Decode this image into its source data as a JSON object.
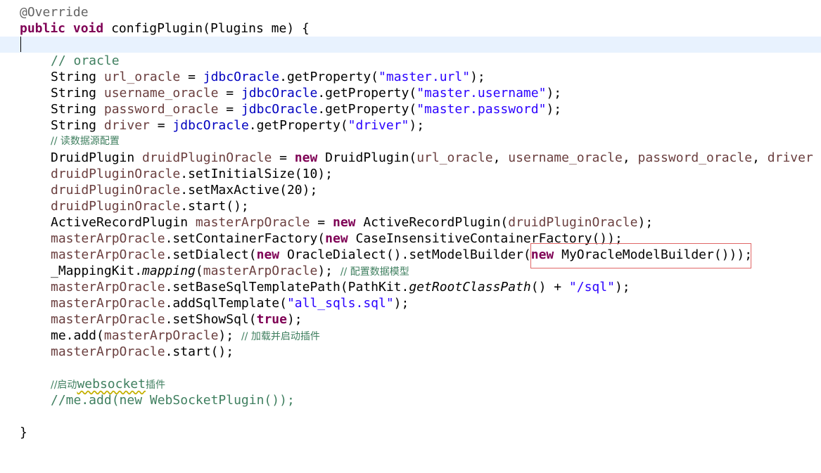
{
  "editor": {
    "annotation": "@Override",
    "signature": {
      "kw_public": "public",
      "kw_void": "void",
      "rest": " configPlugin(Plugins me) {"
    },
    "comment_oracle": "// oracle",
    "l_url": [
      "String ",
      "url_oracle",
      " = ",
      "jdbcOracle",
      ".getProperty(",
      "\"master.url\"",
      ");"
    ],
    "l_user": [
      "String ",
      "username_oracle",
      " = ",
      "jdbcOracle",
      ".getProperty(",
      "\"master.username\"",
      ");"
    ],
    "l_pass": [
      "String ",
      "password_oracle",
      " = ",
      "jdbcOracle",
      ".getProperty(",
      "\"master.password\"",
      ");"
    ],
    "l_driver": [
      "String ",
      "driver",
      " = ",
      "jdbcOracle",
      ".getProperty(",
      "\"driver\"",
      ");"
    ],
    "comment_read": "// 读数据源配置",
    "l_druid": [
      "DruidPlugin ",
      "druidPluginOracle",
      " = ",
      "new",
      " DruidPlugin(",
      "url_oracle",
      ", ",
      "username_oracle",
      ", ",
      "password_oracle",
      ", ",
      "driver"
    ],
    "l_init": [
      "druidPluginOracle",
      ".setInitialSize(10);"
    ],
    "l_max": [
      "druidPluginOracle",
      ".setMaxActive(20);"
    ],
    "l_start1": [
      "druidPluginOracle",
      ".start();"
    ],
    "l_arp": [
      "ActiveRecordPlugin ",
      "masterArpOracle",
      " = ",
      "new",
      " ActiveRecordPlugin(",
      "druidPluginOracle",
      ");"
    ],
    "l_factory": [
      "masterArpOracle",
      ".setContainerFactory(",
      "new",
      " CaseInsensitiveContainerFactory());"
    ],
    "l_dialect": [
      "masterArpOracle",
      ".setDialect(",
      "new",
      " OracleDialect().setModelBuilder(",
      "new",
      " MyOracleModelBuilder()));"
    ],
    "l_mapping": [
      "_MappingKit.",
      "mapping",
      "(",
      "masterArpOracle",
      "); ",
      "// 配置数据模型"
    ],
    "l_base": [
      "masterArpOracle",
      ".setBaseSqlTemplatePath(PathKit.",
      "getRootClassPath",
      "() + ",
      "\"/sql\"",
      ");"
    ],
    "l_add": [
      "masterArpOracle",
      ".addSqlTemplate(",
      "\"all_sqls.sql\"",
      ");"
    ],
    "l_show": [
      "masterArpOracle",
      ".setShowSql(",
      "true",
      ");"
    ],
    "l_me": [
      "me.add(",
      "masterArpOracle",
      "); ",
      "// 加载并启动插件"
    ],
    "l_start2": [
      "masterArpOracle",
      ".start();"
    ],
    "comment_ws1": [
      "//启动",
      "websocket",
      "插件"
    ],
    "comment_ws2": "//me.add(new WebSocketPlugin());",
    "closing_brace": "}"
  },
  "colors": {
    "keyword": "#7f0055",
    "comment": "#3f7f5f",
    "string": "#2a00ff",
    "local_variable": "#6a3e3e",
    "field": "#0000c0",
    "current_line": "#e8f2fe",
    "highlight_box": "#e06666"
  }
}
